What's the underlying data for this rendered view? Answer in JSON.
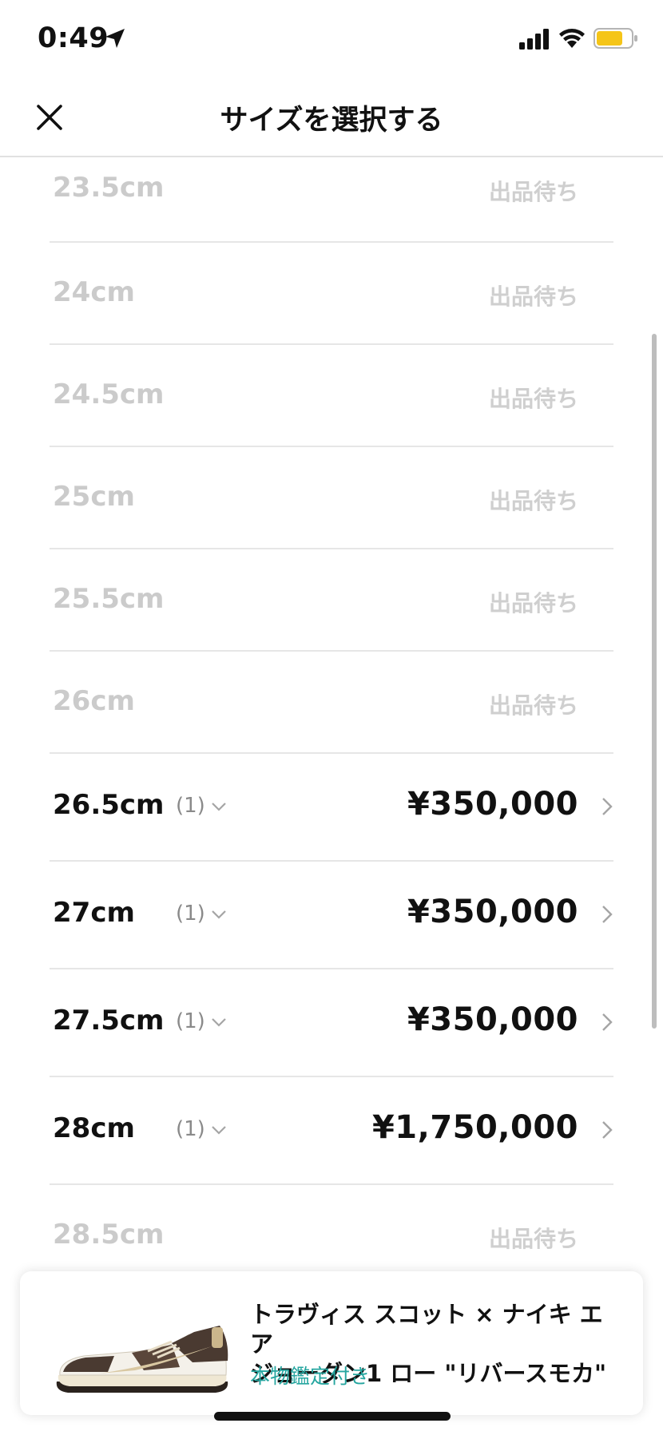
{
  "status_bar": {
    "time": "0:49",
    "battery_color": "#f5c518"
  },
  "header": {
    "title": "サイズを選択する"
  },
  "sizes": [
    {
      "size": "23.5cm",
      "status": "出品待ち"
    },
    {
      "size": "24cm",
      "status": "出品待ち"
    },
    {
      "size": "24.5cm",
      "status": "出品待ち"
    },
    {
      "size": "25cm",
      "status": "出品待ち"
    },
    {
      "size": "25.5cm",
      "status": "出品待ち"
    },
    {
      "size": "26cm",
      "status": "出品待ち"
    },
    {
      "size": "26.5cm",
      "count": "(1)",
      "price": "¥350,000"
    },
    {
      "size": "27cm",
      "count": "(1)",
      "price": "¥350,000"
    },
    {
      "size": "27.5cm",
      "count": "(1)",
      "price": "¥350,000"
    },
    {
      "size": "28cm",
      "count": "(1)",
      "price": "¥1,750,000"
    },
    {
      "size": "28.5cm",
      "status": "出品待ち"
    }
  ],
  "product": {
    "name_line1": "トラヴィス スコット × ナイキ エア",
    "name_line2": "ジョーダン1 ロー \"リバースモカ\"",
    "auth_label": "本物鑑定付き",
    "accent_color": "#26a6a0"
  }
}
